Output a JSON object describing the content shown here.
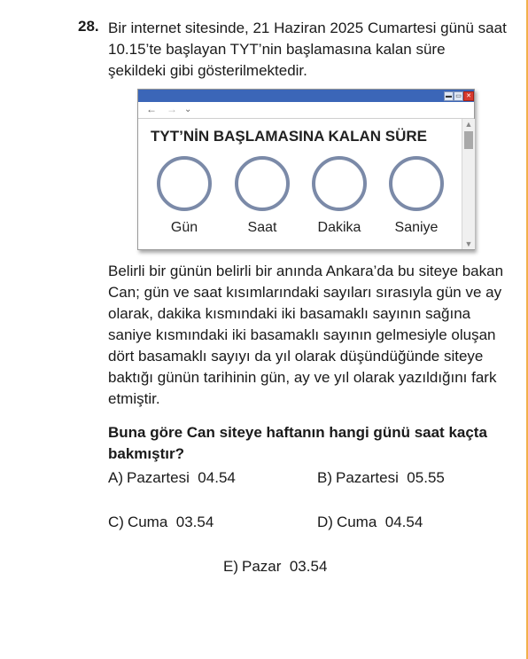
{
  "question": {
    "number": "28.",
    "intro": "Bir internet sitesinde, 21 Haziran 2025 Cumartesi günü saat 10.15’te başlayan TYT’nin başlamasına kalan süre şekildeki gibi gösterilmektedir.",
    "paragraph": "Belirli bir günün belirli bir anında Ankara’da bu siteye bakan Can; gün ve saat kısımlarındaki sayıları sırasıyla gün ve ay olarak, dakika kısmındaki iki basamaklı sayının sağına saniye kısmındaki iki basamaklı sayının gelmesiyle oluşan dört basamaklı sayıyı da yıl olarak düşündüğünde siteye baktığı günün tarihinin gün, ay ve yıl olarak yazıldığını fark etmiştir.",
    "prompt": "Buna göre Can siteye haftanın hangi günü saat kaçta bakmıştır?"
  },
  "browser": {
    "nav_back": "←",
    "nav_forward": "→",
    "nav_dropdown": "⌄",
    "countdown_title": "TYT’NİN BAŞLAMASINA KALAN SÜRE",
    "units": [
      {
        "label": "Gün"
      },
      {
        "label": "Saat"
      },
      {
        "label": "Dakika"
      },
      {
        "label": "Saniye"
      }
    ],
    "colors": {
      "titlebar": "#3b66b8",
      "ring": "#7b8aa8",
      "close": "#d83a2e"
    }
  },
  "options": [
    {
      "letter": "A)",
      "text": "Pazartesi  04.54"
    },
    {
      "letter": "B)",
      "text": "Pazartesi  05.55"
    },
    {
      "letter": "C)",
      "text": "Cuma  03.54"
    },
    {
      "letter": "D)",
      "text": "Cuma  04.54"
    },
    {
      "letter": "E)",
      "text": "Pazar  03.54"
    }
  ]
}
